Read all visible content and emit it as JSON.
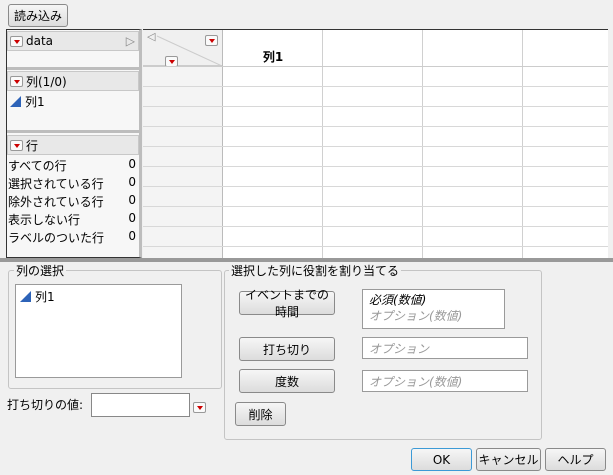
{
  "toolbar": {
    "load_label": "読み込み"
  },
  "table_panel": {
    "name": "data"
  },
  "columns_panel": {
    "header": "列(1/0)",
    "items": [
      "列1"
    ]
  },
  "rows_panel": {
    "header": "行",
    "rows": [
      {
        "label": "すべての行",
        "value": "0"
      },
      {
        "label": "選択されている行",
        "value": "0"
      },
      {
        "label": "除外されている行",
        "value": "0"
      },
      {
        "label": "表示しない行",
        "value": "0"
      },
      {
        "label": "ラベルのついた行",
        "value": "0"
      }
    ]
  },
  "grid": {
    "columns": [
      "列1",
      "",
      ""
    ]
  },
  "select_columns": {
    "title": "列の選択",
    "items": [
      "列1"
    ]
  },
  "censor_value": {
    "label": "打ち切りの値:",
    "value": ""
  },
  "roles": {
    "title": "選択した列に役割を割り当てる",
    "time_to_event": {
      "label": "イベントまでの時間",
      "required": "必須(数値)",
      "optional": "オプション(数値)"
    },
    "censor": {
      "label": "打ち切り",
      "placeholder": "オプション"
    },
    "freq": {
      "label": "度数",
      "placeholder": "オプション(数値)"
    },
    "remove_label": "削除"
  },
  "actions": {
    "ok": "OK",
    "cancel": "キャンセル",
    "help": "ヘルプ"
  }
}
